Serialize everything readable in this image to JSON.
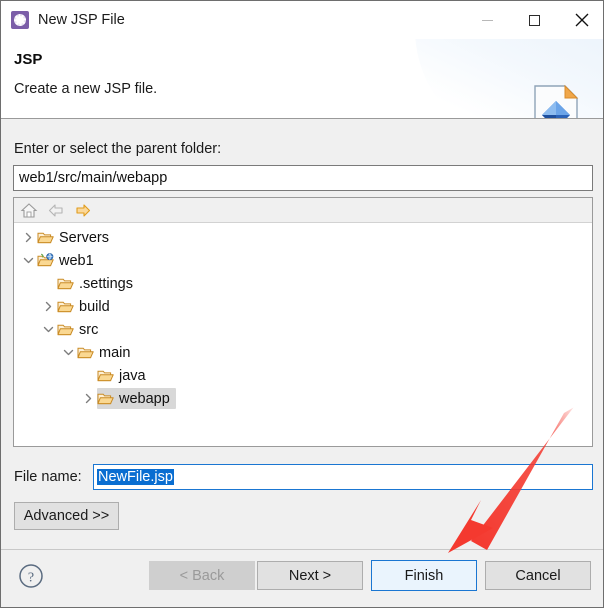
{
  "window": {
    "title": "New JSP File",
    "icon": "jsp-wizard-icon",
    "controls": {
      "minimize": "minimize-icon",
      "maximize": "maximize-icon",
      "close": "close-icon"
    }
  },
  "banner": {
    "title": "JSP",
    "description": "Create a new JSP file.",
    "icon": "jsp-file-icon"
  },
  "form": {
    "parent_folder_label": "Enter or select the parent folder:",
    "parent_folder_value": "web1/src/main/webapp",
    "file_name_label": "File name:",
    "file_name_value": "NewFile.jsp",
    "advanced_label": "Advanced >>"
  },
  "tree_toolbar": {
    "home": "home-icon",
    "back": "back-arrow-icon",
    "forward": "forward-arrow-icon"
  },
  "tree": [
    {
      "label": "Servers",
      "depth": 0,
      "twisty": "collapsed",
      "icon": "folder-icon",
      "selected": false
    },
    {
      "label": "web1",
      "depth": 0,
      "twisty": "expanded",
      "icon": "project-icon",
      "selected": false
    },
    {
      "label": ".settings",
      "depth": 1,
      "twisty": "none",
      "icon": "folder-icon",
      "selected": false
    },
    {
      "label": "build",
      "depth": 1,
      "twisty": "collapsed",
      "icon": "folder-icon",
      "selected": false
    },
    {
      "label": "src",
      "depth": 1,
      "twisty": "expanded",
      "icon": "folder-icon",
      "selected": false
    },
    {
      "label": "main",
      "depth": 2,
      "twisty": "expanded",
      "icon": "folder-icon",
      "selected": false
    },
    {
      "label": "java",
      "depth": 3,
      "twisty": "none",
      "icon": "folder-icon",
      "selected": false
    },
    {
      "label": "webapp",
      "depth": 3,
      "twisty": "collapsed",
      "icon": "folder-icon",
      "selected": true
    }
  ],
  "footer": {
    "help": "help-icon",
    "back_label": "< Back",
    "next_label": "Next >",
    "finish_label": "Finish",
    "cancel_label": "Cancel"
  },
  "annotation": {
    "arrow": "red-arrow-pointing-to-finish",
    "color": "#f4392f"
  },
  "colors": {
    "accent": "#1a76d2",
    "selection": "#0a6ed1",
    "body": "#f0f0f0",
    "folder": "#e8a33d"
  }
}
